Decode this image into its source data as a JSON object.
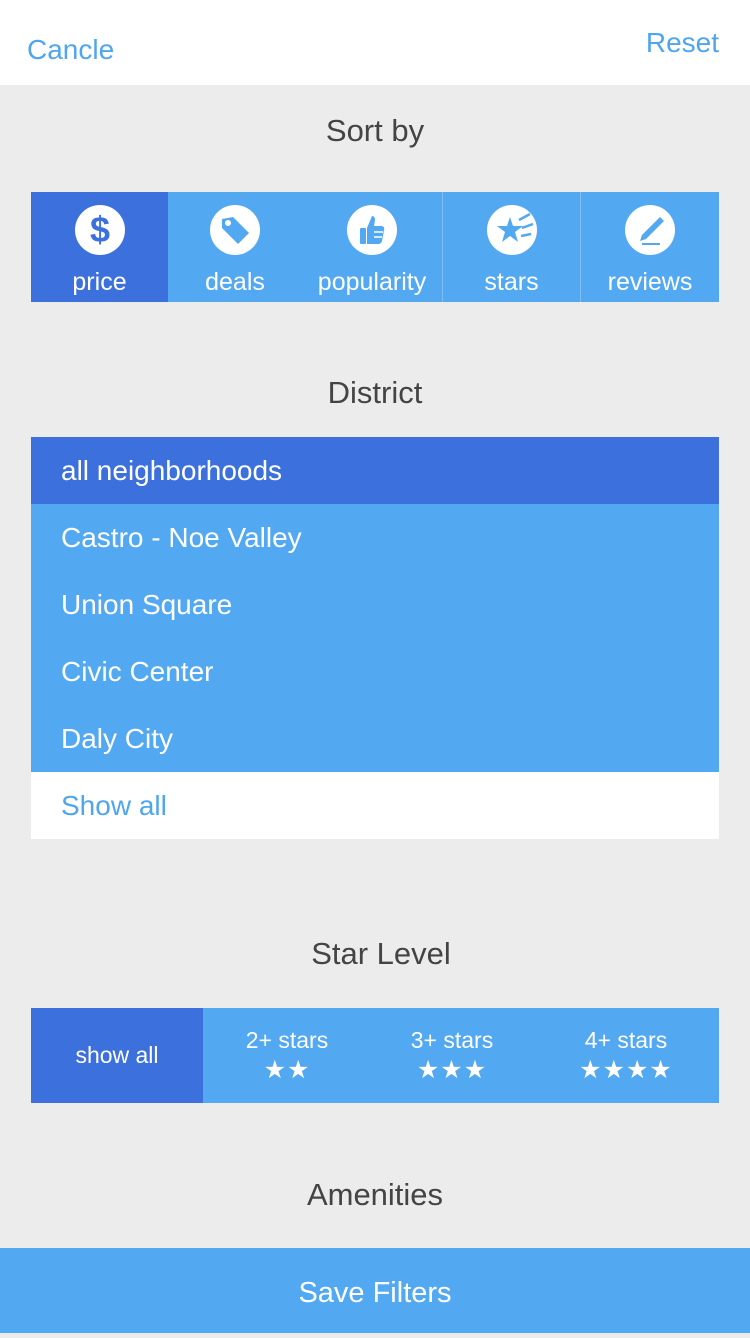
{
  "header": {
    "cancel_label": "Cancle",
    "reset_label": "Reset"
  },
  "sort": {
    "title": "Sort by",
    "options": [
      {
        "label": "price",
        "icon": "dollar-icon",
        "selected": true
      },
      {
        "label": "deals",
        "icon": "tag-icon",
        "selected": false
      },
      {
        "label": "popularity",
        "icon": "thumbs-up-icon",
        "selected": false
      },
      {
        "label": "stars",
        "icon": "shooting-star-icon",
        "selected": false
      },
      {
        "label": "reviews",
        "icon": "pencil-icon",
        "selected": false
      }
    ]
  },
  "district": {
    "title": "District",
    "items": [
      {
        "label": "all neighborhoods",
        "selected": true
      },
      {
        "label": "Castro - Noe Valley",
        "selected": false
      },
      {
        "label": "Union Square",
        "selected": false
      },
      {
        "label": "Civic Center",
        "selected": false
      },
      {
        "label": "Daly City",
        "selected": false
      }
    ],
    "show_all_label": "Show all"
  },
  "star_level": {
    "title": "Star Level",
    "options": [
      {
        "label": "show all",
        "stars": "",
        "selected": true
      },
      {
        "label": "2+ stars",
        "stars": "★★",
        "selected": false
      },
      {
        "label": "3+ stars",
        "stars": "★★★",
        "selected": false
      },
      {
        "label": "4+ stars",
        "stars": "★★★★",
        "selected": false
      }
    ]
  },
  "amenities": {
    "title": "Amenities"
  },
  "footer": {
    "save_label": "Save Filters"
  },
  "colors": {
    "accent": "#52a8f1",
    "selected": "#3c70dd",
    "link": "#4fa6ee",
    "background": "#ececec"
  }
}
